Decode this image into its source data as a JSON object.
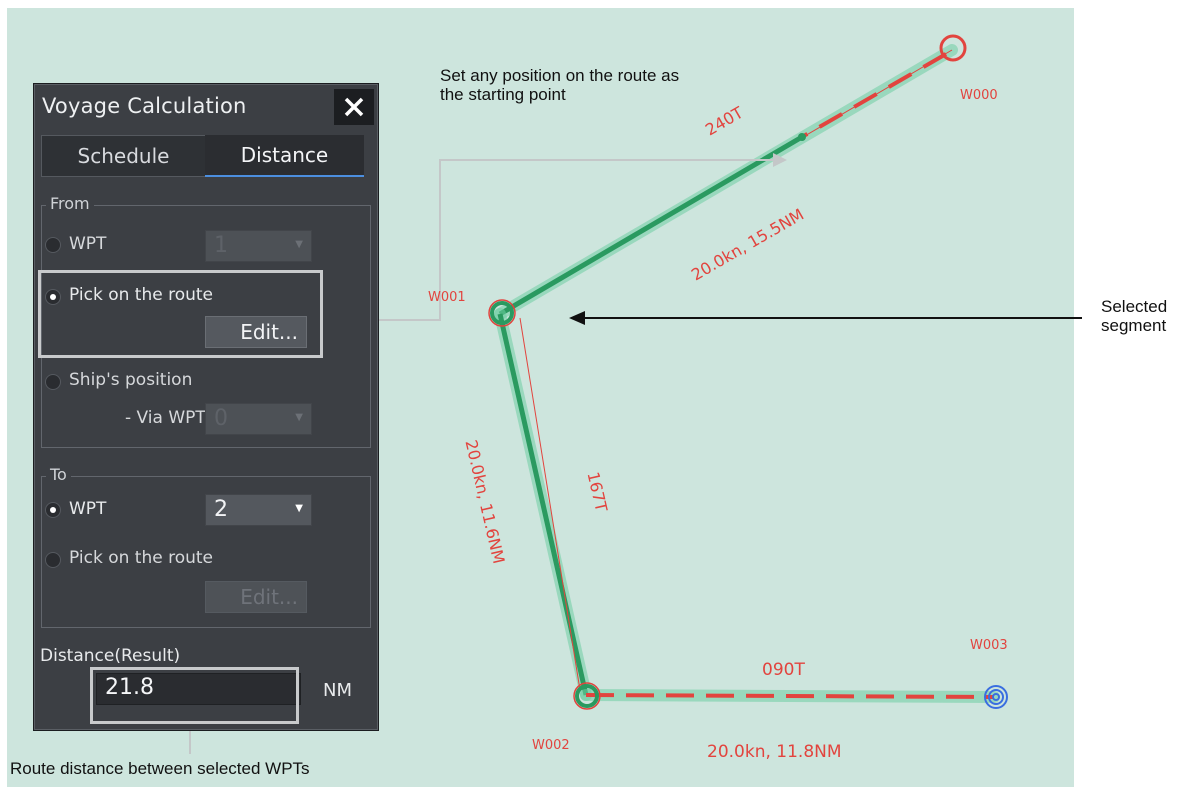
{
  "annotations": {
    "top_callout": "Set any position on the route as\nthe starting point",
    "selected_segment": "Selected\nsegment",
    "bottom_callout": "Route distance between selected WPTs"
  },
  "map": {
    "waypoints": [
      {
        "id": "W000"
      },
      {
        "id": "W001"
      },
      {
        "id": "W002"
      },
      {
        "id": "W003"
      }
    ],
    "legs": [
      {
        "course": "240T",
        "speed_distance": "20.0kn, 15.5NM"
      },
      {
        "course": "167T",
        "speed_distance": "20.0kn, 11.6NM"
      },
      {
        "course": "090T",
        "speed_distance": "20.0kn, 11.8NM"
      }
    ],
    "colors": {
      "background": "#cde5dd",
      "route": "#e2443e",
      "selected": "#2a9a60",
      "own_ship_mark": "#3a6ee0"
    }
  },
  "dialog": {
    "title": "Voyage Calculation",
    "tabs": [
      {
        "label": "Schedule",
        "active": false
      },
      {
        "label": "Distance",
        "active": true
      }
    ],
    "from": {
      "label": "From",
      "wpt_label": "WPT",
      "wpt_value": "1",
      "pick_label": "Pick on the route",
      "pick_selected": true,
      "edit_label": "Edit...",
      "ship_label": "Ship's position",
      "via_label": "- Via WPT",
      "via_value": "0"
    },
    "to": {
      "label": "To",
      "wpt_label": "WPT",
      "wpt_value": "2",
      "wpt_selected": true,
      "pick_label": "Pick on the route",
      "edit_label": "Edit..."
    },
    "result": {
      "label": "Distance(Result)",
      "value": "21.8",
      "unit": "NM"
    }
  }
}
